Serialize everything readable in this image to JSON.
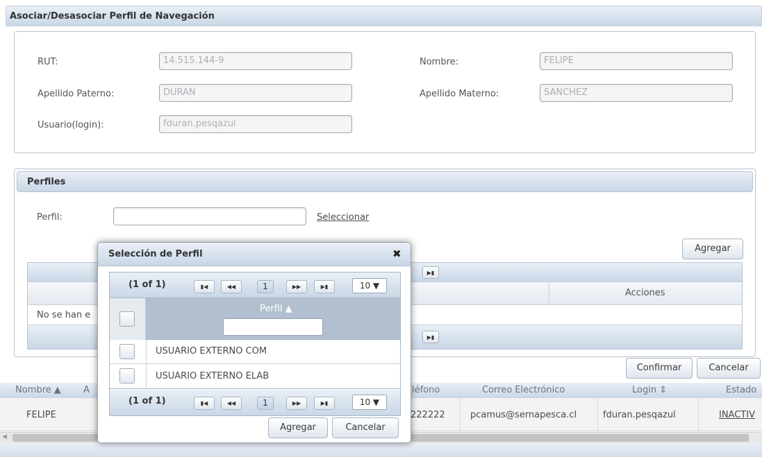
{
  "window": {
    "title": "Asociar/Desasociar Perfil de Navegación"
  },
  "user_info": {
    "rut_label": "RUT:",
    "rut_value": "14.515.144-9",
    "nombre_label": "Nombre:",
    "nombre_value": "FELIPE",
    "apellido_paterno_label": "Apellido Paterno:",
    "apellido_paterno_value": "DURAN",
    "apellido_materno_label": "Apellido Materno:",
    "apellido_materno_value": "SANCHEZ",
    "usuario_label": "Usuario(login):",
    "usuario_value": "fduran.pesqazul"
  },
  "perfiles": {
    "title": "Perfiles",
    "perfil_label": "Perfil:",
    "perfil_value": "",
    "seleccionar_link": "Seleccionar",
    "agregar_button": "Agregar",
    "acciones_header": "Acciones",
    "empty_message": "No se han e"
  },
  "footer_actions": {
    "confirmar": "Confirmar",
    "cancelar": "Cancelar"
  },
  "background_table": {
    "headers": [
      "Nombre ▲",
      "A",
      "léfono",
      "Correo Electrónico",
      "Login ⇕",
      "Estado"
    ],
    "row": {
      "nombre": "FELIPE",
      "telefono": "222222",
      "correo": "pcamus@sernapesca.cl",
      "login": "fduran.pesqazul",
      "estado": "INACTIV"
    }
  },
  "dialog": {
    "title": "Selección de Perfil",
    "close_glyph": "✖",
    "paginator": {
      "info": "(1 of 1)",
      "first": "⏮",
      "prev": "◀◀",
      "page": "1",
      "next": "▶▶",
      "last": "⏭",
      "rows_per_page": "10 ▼"
    },
    "column_header": "Perfil ▲",
    "filter_value": "",
    "rows": [
      {
        "label": "USUARIO EXTERNO COM"
      },
      {
        "label": "USUARIO EXTERNO ELAB"
      }
    ],
    "agregar_button": "Agregar",
    "cancelar_button": "Cancelar"
  },
  "colors": {
    "header_gradient_top": "#e9eff6",
    "header_gradient_bottom": "#c9d7e6",
    "border": "#b9c4cf"
  }
}
